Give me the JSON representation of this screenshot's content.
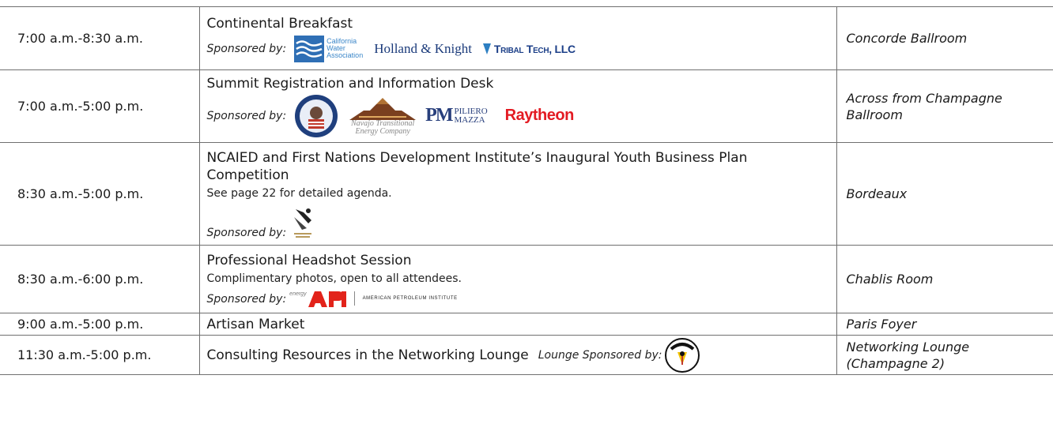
{
  "sponsor_label": "Sponsored by:",
  "rows": [
    {
      "time": "7:00 a.m.-8:30 a.m.",
      "title": "Continental Breakfast",
      "location": "Concorde Ballroom",
      "sponsors": {
        "cwa": "California\nWater\nAssociation",
        "hk": "Holland & Knight",
        "tribal": "Tribal Tech, LLC"
      }
    },
    {
      "time": "7:00 a.m.-5:00 p.m.",
      "title": "Summit Registration and Information Desk",
      "location": "Across from Champagne Ballroom",
      "sponsors": {
        "navajo": "Navajo Transitional\nEnergy Company",
        "pm_mark": "PM",
        "pm": "PILIERO\nMAZZA",
        "raytheon": "Raytheon"
      }
    },
    {
      "time": "8:30 a.m.-5:00 p.m.",
      "title": "NCAIED and First Nations Development Institute’s Inaugural Youth Business Plan Competition",
      "description": "See page 22 for detailed agenda.",
      "location": "Bordeaux"
    },
    {
      "time": "8:30 a.m.-6:00 p.m.",
      "title": "Professional Headshot Session",
      "description": "Complimentary photos, open to all attendees.",
      "location": "Chablis Room",
      "sponsors": {
        "api_energy": "energy",
        "api_org": "AMERICAN PETROLEUM INSTITUTE"
      }
    },
    {
      "time": "9:00 a.m.-5:00 p.m.",
      "title": "Artisan Market",
      "location": "Paris Foyer"
    },
    {
      "time": "11:30 a.m.-5:00 p.m.",
      "title": "Consulting Resources in the Networking Lounge",
      "sponsor_label": "Lounge Sponsored by:",
      "location": "Networking Lounge (Champagne 2)"
    }
  ]
}
